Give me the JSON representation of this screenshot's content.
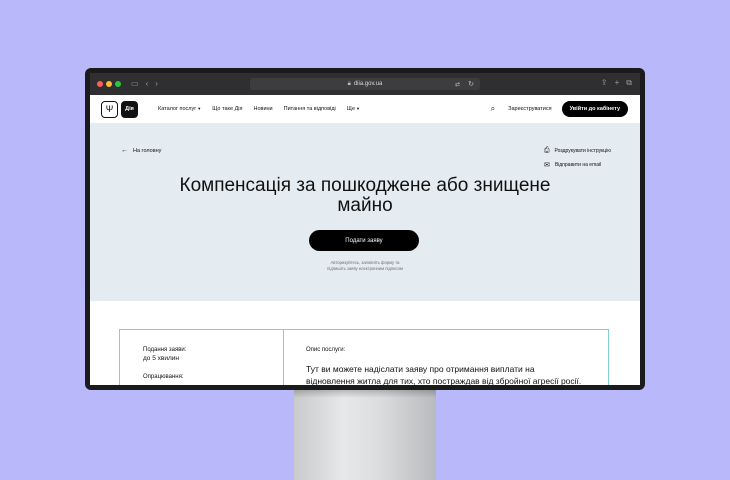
{
  "browser": {
    "url": "diia.gov.ua"
  },
  "header": {
    "nav": [
      {
        "label": "Каталог послуг",
        "caret": true
      },
      {
        "label": "Що таке Дія",
        "caret": false
      },
      {
        "label": "Новини",
        "caret": false
      },
      {
        "label": "Питання та відповіді",
        "caret": false
      },
      {
        "label": "Ще",
        "caret": true
      }
    ],
    "logo_label": "Дія",
    "register_label": "Зареєструватися",
    "cabinet_label": "Увійти до кабінету"
  },
  "hero": {
    "back_label": "На головну",
    "print_label": "Роздрукувати інструкцію",
    "email_label": "Відправити на email",
    "title_line1": "Компенсація за пошкоджене або знищене",
    "title_line2": "майно",
    "submit_label": "Подати заяву",
    "note_line1": "Авторизуйтесь, заповніть форму та",
    "note_line2": "підпишіть заяву електронним підписом"
  },
  "info": {
    "submit_time_label": "Подання заяви:",
    "submit_time_value": "до 5 хвилин",
    "processing_label": "Опрацювання:",
    "description_label": "Опис послуги:",
    "description_line1": "Тут ви можете надіслати заяву про отримання виплати на",
    "description_line2": "відновлення житла для тих, хто постраждав від збройної агресії росії."
  },
  "colors": {
    "background": "#b9b8fb",
    "hero_background": "#e4ebf1",
    "card_border": "#7fd0d6",
    "primary_button": "#000000"
  },
  "icons": {
    "back": "arrow-left-icon",
    "print": "printer-icon",
    "email": "mail-icon",
    "search": "search-icon"
  }
}
